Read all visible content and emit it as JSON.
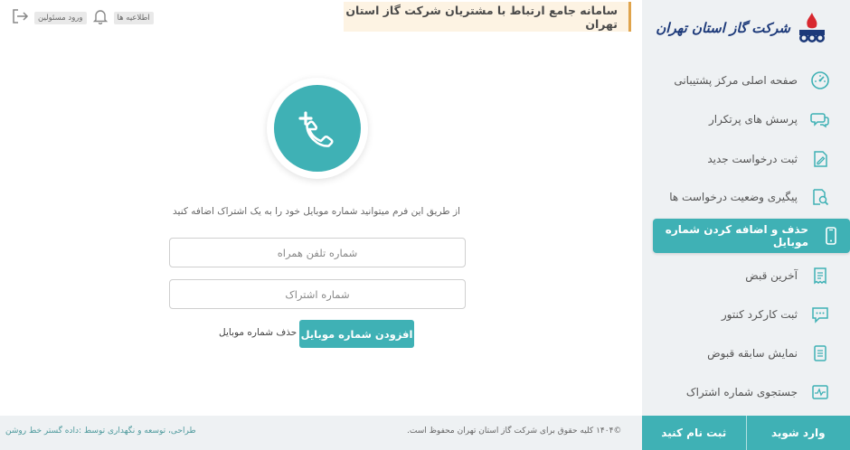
{
  "header": {
    "title": "سامانه جامع ارتباط با مشتریان شرکت گاز استان تهران",
    "notifications_label": "اطلاعیه ها",
    "admin_login_label": "ورود مسئولین"
  },
  "logo": {
    "text": "شرکت گاز استان تهران"
  },
  "sidebar": {
    "items": [
      {
        "label": "صفحه اصلی مرکز پشتیبانی",
        "icon": "dashboard-icon"
      },
      {
        "label": "پرسش های پرتکرار",
        "icon": "chat-icon"
      },
      {
        "label": "ثبت درخواست جدید",
        "icon": "edit-document-icon"
      },
      {
        "label": "پیگیری وضعیت درخواست ها",
        "icon": "search-document-icon"
      },
      {
        "label": "حذف و اضافه کردن شماره موبایل",
        "icon": "mobile-icon",
        "active": true
      },
      {
        "label": "آخرین قبض",
        "icon": "bill-icon"
      },
      {
        "label": "ثبت کارکرد کنتور",
        "icon": "message-icon"
      },
      {
        "label": "نمایش سابقه قبوض",
        "icon": "history-icon"
      },
      {
        "label": "جستجوی شماره اشتراک",
        "icon": "pulse-icon"
      }
    ]
  },
  "main": {
    "description": "از طریق این فرم میتوانید شماره موبایل خود را به یک اشتراک اضافه کنید",
    "mobile_placeholder": "شماره تلفن همراه",
    "subscription_placeholder": "شماره اشتراک",
    "add_button": "افزودن شماره موبایل",
    "delete_link": "حذف شماره موبایل"
  },
  "footer": {
    "copyright": "©۱۴۰۴ کلیه حقوق برای  شرکت گاز استان تهران محفوظ است.",
    "credit": "طراحی، توسعه و نگهداری توسط :داده گستر خط روشن",
    "register_label": "ثبت نام کنید",
    "login_label": "وارد شوید"
  },
  "colors": {
    "accent": "#3fb1b5",
    "title_border": "#e0a44c",
    "logo_blue": "#1d3a7a",
    "logo_red": "#d8282f"
  }
}
